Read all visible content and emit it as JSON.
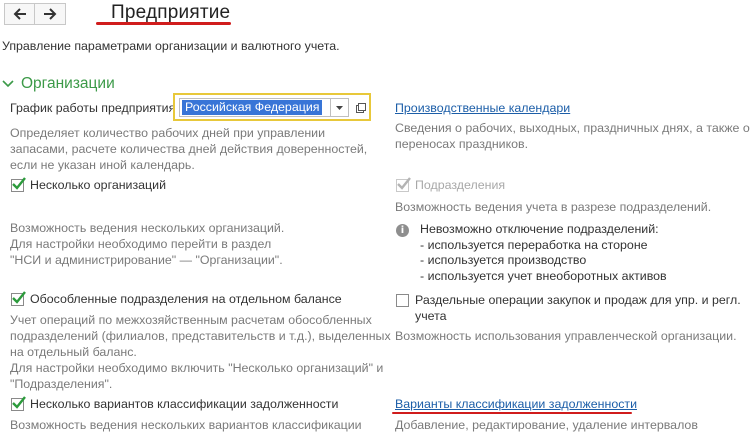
{
  "header": {
    "title": "Предприятие",
    "subtitle": "Управление параметрами организации и валютного учета."
  },
  "section": {
    "title": "Организации"
  },
  "schedule": {
    "label": "График работы предприятия:",
    "value": "Российская Федерация",
    "hint": [
      "Определяет количество рабочих дней при управлении",
      "запасами, расчете количества дней действия доверенностей,",
      "если не указан иной календарь."
    ]
  },
  "calendars": {
    "link": "Производственные календари",
    "hint": [
      "Сведения о рабочих, выходных, праздничных днях, а также о",
      "переносах праздников."
    ]
  },
  "multi_org": {
    "label": "Несколько организаций",
    "checked": true,
    "hint": [
      "Возможность ведения нескольких организаций.",
      "Для настройки необходимо перейти в раздел",
      "\"НСИ и администрирование\" — \"Организации\"."
    ]
  },
  "subdivisions": {
    "label": "Подразделения",
    "checked": true,
    "hint": "Возможность ведения учета в разрезе подразделений.",
    "info": [
      "Невозможно отключение подразделений:",
      "- используется переработка на стороне",
      "- используется производство",
      "- используется учет внеоборотных активов"
    ]
  },
  "separate_units": {
    "label": "Обособленные подразделения на отдельном балансе",
    "checked": true,
    "hint": [
      "Учет операций по межхозяйственным расчетам обособленных",
      "подразделений (филиалов, представительств и т.д.), выделенных",
      "на отдельный баланс.",
      "Для настройки необходимо включить \"Несколько организаций\" и",
      "\"Подразделения\"."
    ]
  },
  "separate_ops": {
    "label": [
      "Раздельные операции закупок и продаж для упр. и регл.",
      "учета"
    ],
    "checked": false,
    "hint": "Возможность использования управленческой организации."
  },
  "debt_variants": {
    "label": "Несколько вариантов классификации задолженности",
    "checked": true,
    "hint": "Возможность ведения нескольких вариантов классификации"
  },
  "debt_link": {
    "link": "Варианты классификации задолженности",
    "hint": "Добавление, редактирование, удаление интервалов"
  },
  "colors": {
    "accent_green": "#3c9a48",
    "link_blue": "#1c5ea8",
    "highlight_red": "#d01c1c",
    "focus_yellow": "#e8c83a",
    "selection_blue": "#3875d7"
  }
}
